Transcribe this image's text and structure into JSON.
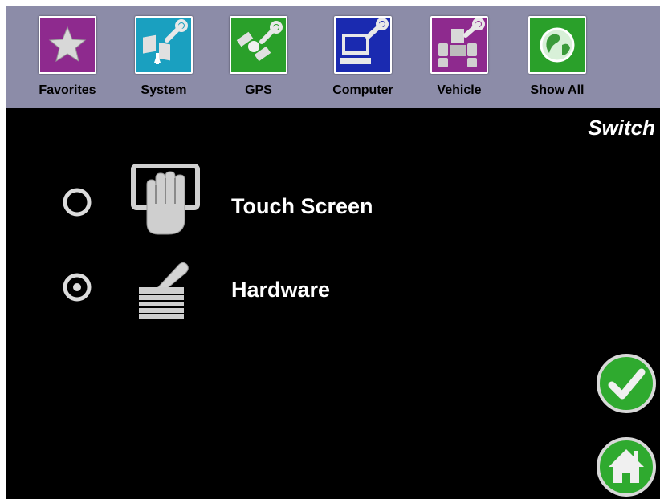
{
  "toolbar": {
    "items": [
      {
        "label": "Favorites",
        "icon": "star-icon",
        "color": "#8e2a8e"
      },
      {
        "label": "System",
        "icon": "system-wrench-icon",
        "color": "#1aa0c0"
      },
      {
        "label": "GPS",
        "icon": "gps-satellite-icon",
        "color": "#2aa02a"
      },
      {
        "label": "Computer",
        "icon": "computer-icon",
        "color": "#1a2ab0"
      },
      {
        "label": "Vehicle",
        "icon": "vehicle-icon",
        "color": "#8e2a8e"
      },
      {
        "label": "Show All",
        "icon": "globe-icon",
        "color": "#2aa02a"
      }
    ]
  },
  "page": {
    "title": "Switch"
  },
  "options": [
    {
      "label": "Touch Screen",
      "icon": "touch-hand-icon",
      "selected": false
    },
    {
      "label": "Hardware",
      "icon": "hardware-joystick-icon",
      "selected": true
    }
  ],
  "actions": {
    "confirm_icon": "checkmark-icon",
    "home_icon": "home-icon",
    "accent_color": "#2faa2f"
  },
  "colors": {
    "background": "#000000",
    "toolbar": "#8c8ca8",
    "text": "#ffffff"
  }
}
